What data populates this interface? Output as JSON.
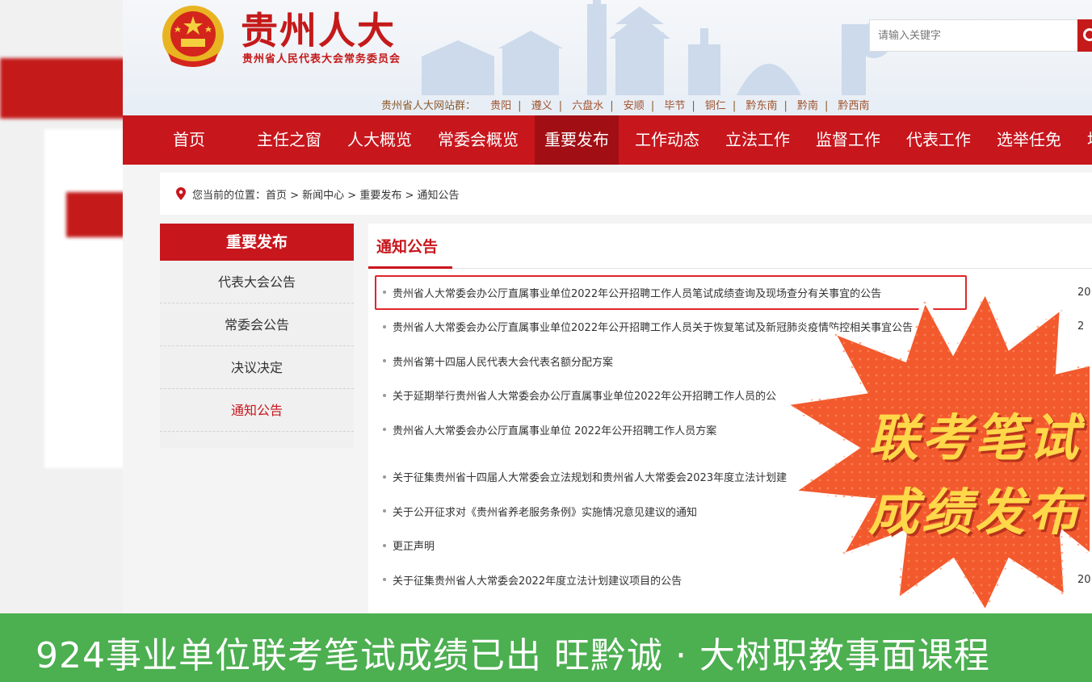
{
  "header": {
    "logo_title": "贵州人大",
    "logo_subtitle": "贵州省人民代表大会常务委员会",
    "search_placeholder": "请输入关键字",
    "sites_label": "贵州省人大网站群：",
    "sites": [
      "贵阳",
      "遵义",
      "六盘水",
      "安顺",
      "毕节",
      "铜仁",
      "黔东南",
      "黔南",
      "黔西南"
    ]
  },
  "nav": {
    "items": [
      "首页",
      "主任之窗",
      "人大概览",
      "常委会概览",
      "重要发布",
      "工作动态",
      "立法工作",
      "监督工作",
      "代表工作",
      "选举任免",
      "地"
    ],
    "active_index": 4
  },
  "breadcrumb": {
    "prefix": "您当前的位置：",
    "path": "首页 > 新闻中心 > 重要发布 > 通知公告"
  },
  "sidebar": {
    "title": "重要发布",
    "items": [
      "代表大会公告",
      "常委会公告",
      "决议决定",
      "通知公告"
    ],
    "active_index": 3
  },
  "main": {
    "title": "通知公告",
    "rows": [
      {
        "title": "贵州省人大常委会办公厅直属事业单位2022年公开招聘工作人员笔试成绩查询及现场查分有关事宜的公告",
        "date": "20"
      },
      {
        "title": "贵州省人大常委会办公厅直属事业单位2022年公开招聘工作人员关于恢复笔试及新冠肺炎疫情防控相关事宜公告",
        "date": "2"
      },
      {
        "title": "贵州省第十四届人民代表大会代表名额分配方案",
        "date": ""
      },
      {
        "title": "关于延期举行贵州省人大常委会办公厅直属事业单位2022年公开招聘工作人员的公",
        "date": ""
      },
      {
        "title": "贵州省人大常委会办公厅直属事业单位 2022年公开招聘工作人员方案",
        "date": ""
      },
      {
        "title": "关于征集贵州省十四届人大常委会立法规划和贵州省人大常委会2023年度立法计划建",
        "date": ""
      },
      {
        "title": "关于公开征求对《贵州省养老服务条例》实施情况意见建议的通知",
        "date": ""
      },
      {
        "title": "更正声明",
        "date": ""
      },
      {
        "title": "关于征集贵州省人大常委会2022年度立法计划建议项目的公告",
        "date": "20"
      }
    ]
  },
  "promo": {
    "line1": "联考笔试",
    "line2": "成绩发布",
    "color_burst": "#f25a2e",
    "color_text": "#ffd84a"
  },
  "banner": {
    "text": "924事业单位联考笔试成绩已出  旺黔诚 · 大树职教事面课程",
    "color": "#4caf50"
  },
  "colors": {
    "brand_red": "#c8161d",
    "highlight_border": "#e0262a"
  }
}
